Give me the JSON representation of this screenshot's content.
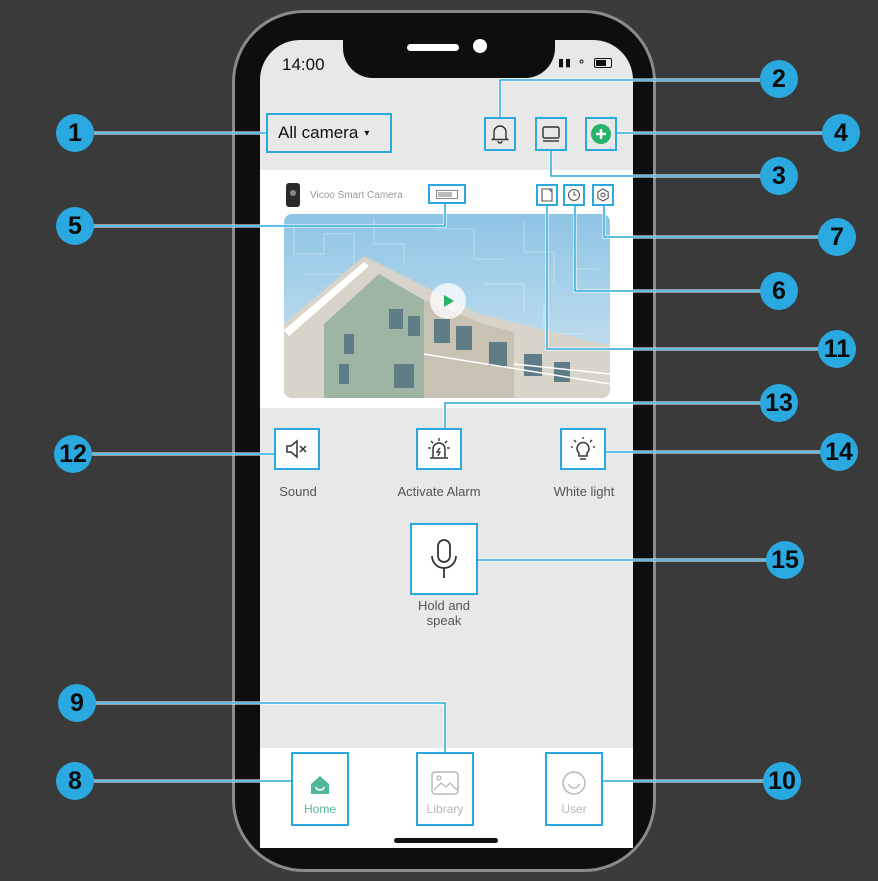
{
  "status_bar": {
    "time": "14:00",
    "signal": "❡≡"
  },
  "header": {
    "title": "All camera",
    "caret": "▾"
  },
  "camera_card": {
    "name": "Vicoo Smart Camera"
  },
  "controls": {
    "sound": "Sound",
    "alarm": "Activate Alarm",
    "white_light": "White light",
    "talk_line1": "Hold and",
    "talk_line2": "speak"
  },
  "tabs": [
    {
      "label": "Home",
      "color": "#4fb89a",
      "active": true
    },
    {
      "label": "Library",
      "color": "#b8b8b8",
      "active": false
    },
    {
      "label": "User",
      "color": "#b8b8b8",
      "active": false
    }
  ],
  "callouts": [
    "1",
    "2",
    "3",
    "4",
    "5",
    "6",
    "7",
    "8",
    "9",
    "10",
    "11",
    "12",
    "13",
    "14",
    "15"
  ],
  "colors": {
    "callout": "#2aa9e0",
    "accent_green": "#27b36a",
    "background": "#3a3a3a"
  }
}
